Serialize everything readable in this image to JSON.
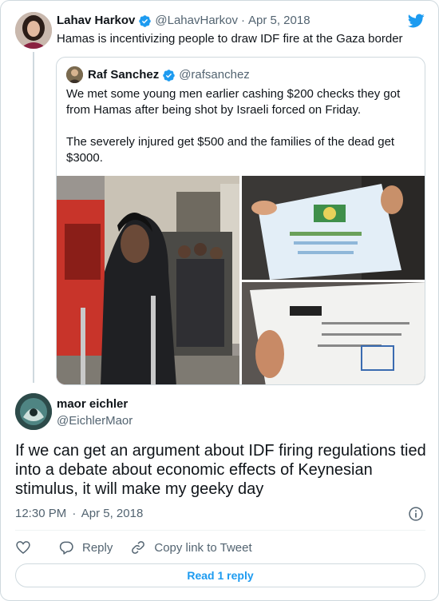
{
  "parent_tweet": {
    "author_name": "Lahav Harkov",
    "author_handle": "@LahavHarkov",
    "separator": "·",
    "date": "Apr 5, 2018",
    "text": "Hamas is incentivizing people to draw IDF fire at the Gaza border"
  },
  "quoted_tweet": {
    "author_name": "Raf Sanchez",
    "author_handle": "@rafsanchez",
    "text_p1": "We met some young men earlier cashing $200 checks they got from Hamas after being shot by Israeli forced on Friday.",
    "text_p2": "The severely injured get $500 and the families of the dead get $3000."
  },
  "reply_tweet": {
    "author_name": "maor eichler",
    "author_handle": "@EichlerMaor",
    "text": "If we can get an argument about IDF firing regulations tied into a debate about economic effects of Keynesian stimulus, it will make my geeky day",
    "time": "12:30 PM",
    "separator": "·",
    "date": "Apr 5, 2018"
  },
  "actions": {
    "reply_label": "Reply",
    "copy_link_label": "Copy link to Tweet",
    "read_replies_label": "Read 1 reply"
  },
  "colors": {
    "accent": "#1d9bf0",
    "text_primary": "#0f1419",
    "text_secondary": "#536471",
    "border": "#cfd9de"
  },
  "icons": [
    "verified-badge-icon",
    "twitter-bird-icon",
    "info-icon",
    "heart-icon",
    "reply-icon",
    "link-icon"
  ]
}
